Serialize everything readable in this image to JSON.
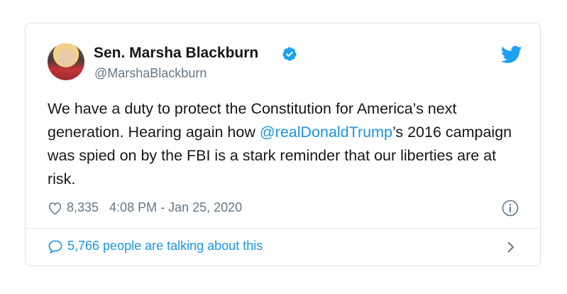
{
  "tweet": {
    "author_name": "Sen. Marsha Blackburn",
    "handle": "@MarshaBlackburn",
    "text_before": "We have a duty to protect the Constitution for America’s next generation. Hearing again how ",
    "mention": "@realDonaldTrump",
    "text_after": "’s 2016 campaign was spied on by the FBI is a stark reminder that our liberties are at risk.",
    "likes": "8,335",
    "timestamp": "4:08 PM - Jan 25, 2020",
    "conversation": "5,766 people are talking about this"
  },
  "icons": {
    "avatar": "avatar",
    "verified": "verified-badge-icon",
    "brand": "twitter-bird-icon",
    "like": "heart-icon",
    "info": "info-icon",
    "reply": "speech-bubble-icon",
    "more": "chevron-right-icon"
  },
  "colors": {
    "accent": "#1b95e0",
    "text": "#14171a",
    "secondary": "#657786",
    "border": "#d9e1e8"
  }
}
